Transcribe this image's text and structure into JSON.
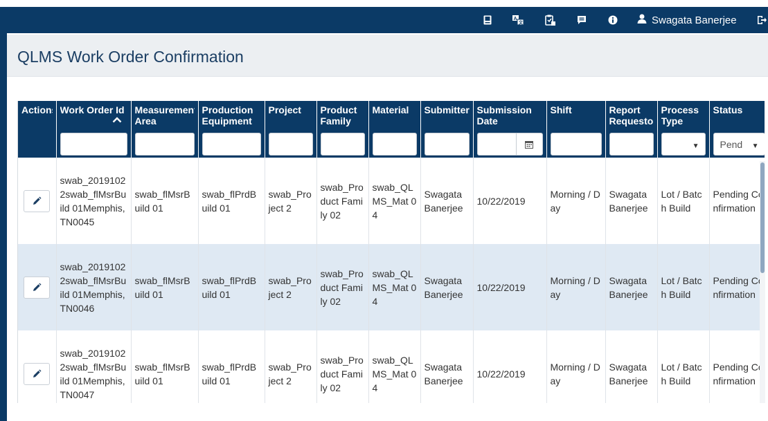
{
  "navbar": {
    "icons": [
      "book-icon",
      "translate-icon",
      "clipboard-icon",
      "message-icon",
      "info-icon",
      "user-icon",
      "logout-icon"
    ],
    "user_name": "Swagata Banerjee"
  },
  "page": {
    "title": "QLMS Work Order Confirmation"
  },
  "grid": {
    "columns": [
      {
        "key": "actions",
        "label": "Actions",
        "filter": "none"
      },
      {
        "key": "work_order_id",
        "label": "Work Order Id",
        "filter": "text",
        "sorted": "ascending"
      },
      {
        "key": "measurement_area",
        "label": "Measurement Area",
        "filter": "text"
      },
      {
        "key": "production_equipment",
        "label": "Production Equipment",
        "filter": "text"
      },
      {
        "key": "project",
        "label": "Project",
        "filter": "text"
      },
      {
        "key": "product_family",
        "label": "Product Family",
        "filter": "text"
      },
      {
        "key": "material",
        "label": "Material",
        "filter": "text"
      },
      {
        "key": "submitter",
        "label": "Submitter",
        "filter": "text"
      },
      {
        "key": "submission_date",
        "label": "Submission Date",
        "filter": "date"
      },
      {
        "key": "shift",
        "label": "Shift",
        "filter": "text"
      },
      {
        "key": "report_requestor",
        "label": "Report Requestor",
        "filter": "text"
      },
      {
        "key": "process_type",
        "label": "Process Type",
        "filter": "select",
        "selected": ""
      },
      {
        "key": "status",
        "label": "Status",
        "filter": "select",
        "selected": "Pend"
      }
    ],
    "rows": [
      {
        "work_order_id": "swab_20191022swab_flMsrBuild 01Memphis, TN0045",
        "measurement_area": "swab_flMsrBuild 01",
        "production_equipment": "swab_flPrdBuild 01",
        "project": "swab_Project 2",
        "product_family": "swab_Product Family 02",
        "material": "swab_QLMS_Mat 04",
        "submitter": "Swagata Banerjee",
        "submission_date": "10/22/2019",
        "shift": "Morning / Day",
        "report_requestor": "Swagata Banerjee",
        "process_type": "Lot / Batch Build",
        "status": "Pending Confirmation"
      },
      {
        "work_order_id": "swab_20191022swab_flMsrBuild 01Memphis, TN0046",
        "measurement_area": "swab_flMsrBuild 01",
        "production_equipment": "swab_flPrdBuild 01",
        "project": "swab_Project 2",
        "product_family": "swab_Product Family 02",
        "material": "swab_QLMS_Mat 04",
        "submitter": "Swagata Banerjee",
        "submission_date": "10/22/2019",
        "shift": "Morning / Day",
        "report_requestor": "Swagata Banerjee",
        "process_type": "Lot / Batch Build",
        "status": "Pending Confirmation"
      },
      {
        "work_order_id": "swab_20191022swab_flMsrBuild 01Memphis, TN0047",
        "measurement_area": "swab_flMsrBuild 01",
        "production_equipment": "swab_flPrdBuild 01",
        "project": "swab_Project 2",
        "product_family": "swab_Product Family 02",
        "material": "swab_QLMS_Mat 04",
        "submitter": "Swagata Banerjee",
        "submission_date": "10/22/2019",
        "shift": "Morning / Day",
        "report_requestor": "Swagata Banerjee",
        "process_type": "Lot / Batch Build",
        "status": "Pending Confirmation"
      }
    ]
  },
  "colors": {
    "navbar": "#0b3a66",
    "title_bg": "#eceff2",
    "row_alt": "#dfe9f3",
    "title_text": "#1b3e63"
  }
}
